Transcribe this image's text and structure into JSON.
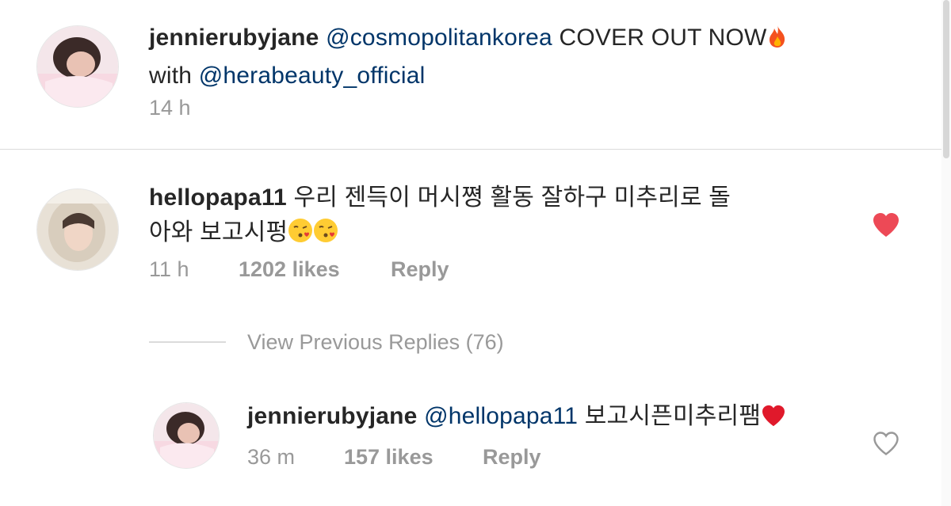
{
  "caption": {
    "username": "jennierubyjane",
    "mention": "@cosmopolitankorea",
    "text": "COVER OUT NOW",
    "emoji": "fire-emoji",
    "line2_prefix": "with",
    "mention2": "@herabeauty_official",
    "time": "14 h"
  },
  "comment": {
    "username": "hellopapa11",
    "text_line1": "우리 젠득이 머시쪙 활동 잘하구 미추리로 돌",
    "text_line2": "아와 보고시펑",
    "emoji": "kissing-face-emoji",
    "time": "11 h",
    "likes": "1202 likes",
    "reply_label": "Reply",
    "liked": true,
    "heart_color": "#ed4956"
  },
  "view_replies": {
    "label": "View Previous Replies (76)"
  },
  "reply": {
    "username": "jennierubyjane",
    "mention": "@hellopapa11",
    "text": "보고시픈미추리팸",
    "emoji": "red-heart-emoji",
    "time": "36 m",
    "likes": "157 likes",
    "reply_label": "Reply",
    "liked": false
  }
}
